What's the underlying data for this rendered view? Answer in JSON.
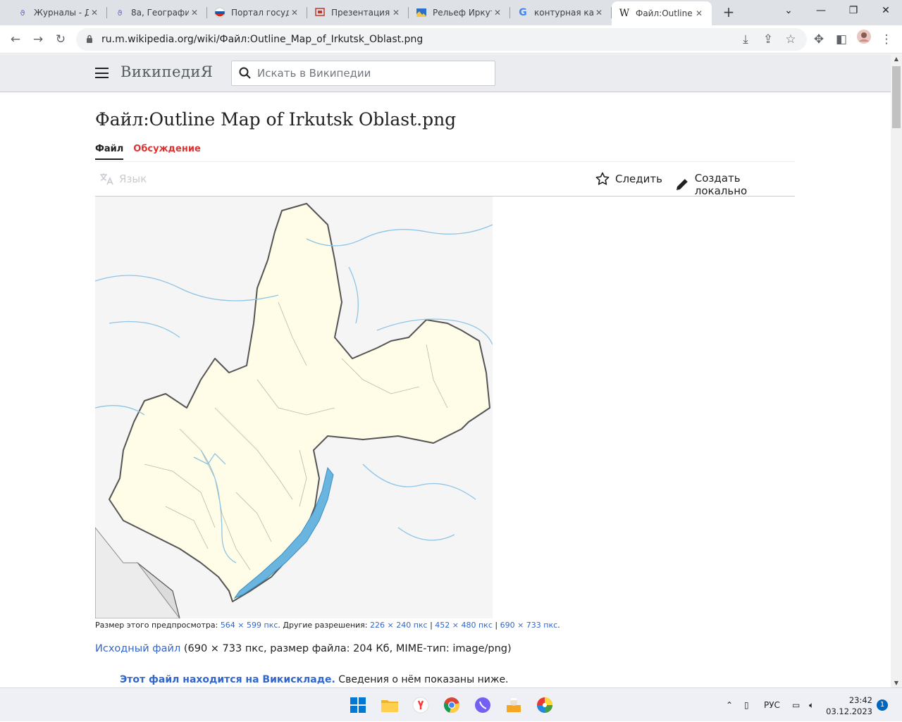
{
  "browser": {
    "tabs": [
      {
        "title": "Журналы - Дн",
        "favicon": "dnevnik-icon"
      },
      {
        "title": "8а, Географи",
        "favicon": "dnevnik-icon"
      },
      {
        "title": "Портал госуд",
        "favicon": "russia-flag-icon"
      },
      {
        "title": "Презентация",
        "favicon": "presentation-icon"
      },
      {
        "title": "Рельеф Иркут",
        "favicon": "page-icon"
      },
      {
        "title": "контурная кар",
        "favicon": "google-icon"
      },
      {
        "title": "Файл:Outline",
        "favicon": "wikipedia-icon",
        "active": true
      }
    ],
    "new_tab": "+",
    "url": "ru.m.wikipedia.org/wiki/Файл:Outline_Map_of_Irkutsk_Oblast.png"
  },
  "wiki": {
    "logo": "ВикипедиЯ",
    "search_placeholder": "Искать в Википедии",
    "title": "Файл:Outline Map of Irkutsk Oblast.png",
    "tab_file": "Файл",
    "tab_discussion": "Обсуждение",
    "language": "Язык",
    "watch": "Следить",
    "create_local": "Создать локально",
    "caption": {
      "prefix": "Размер этого предпросмотра: ",
      "preview_size": "564 × 599 пкс",
      "middle": ". Другие разрешения: ",
      "res1": "226 × 240 пкс",
      "sep": " | ",
      "res2": "452 × 480 пкс",
      "res3": "690 × 733 пкс",
      "end": "."
    },
    "original": {
      "link": "Исходный файл",
      "details": " (690 × 733 пкс, размер файла: 204 Кб, MIME-тип: image/png)"
    },
    "commons": {
      "bold": "Этот файл находится на Викискладе.",
      "rest": " Сведения о нём показаны ниже."
    }
  },
  "taskbar": {
    "lang": "РУС",
    "time": "23:42",
    "date": "03.12.2023",
    "notifications": "1"
  }
}
